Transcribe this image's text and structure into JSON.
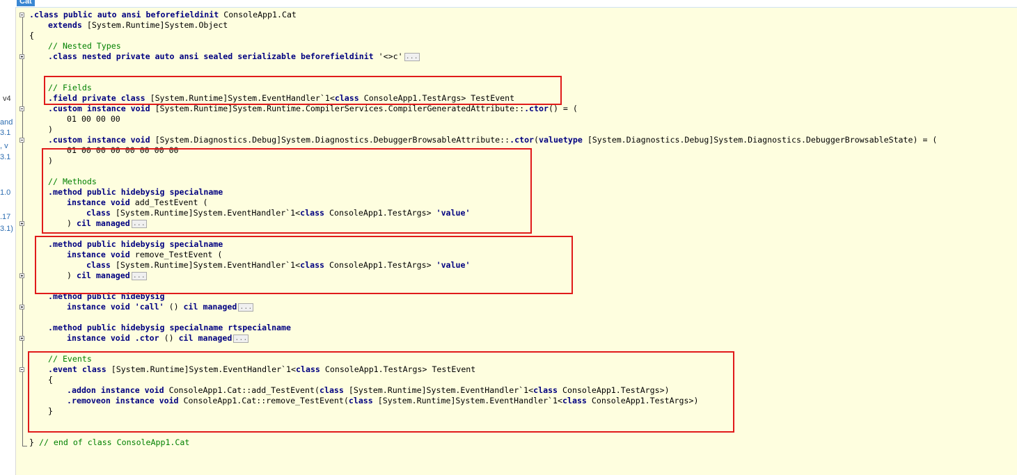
{
  "tab": {
    "label": "Cat"
  },
  "left_pane_fragments": [
    "v4",
    "and",
    "3.1",
    ", v",
    "3.1",
    "1.0",
    ".17",
    "3.1)"
  ],
  "code": {
    "class_line": {
      "kw": ".class public auto ansi beforefieldinit",
      "name": " ConsoleApp1.Cat"
    },
    "extends_line": {
      "kw": "extends",
      "text": " [System.Runtime]System.Object"
    },
    "brace_open": "{",
    "nested_comment": "// Nested Types",
    "nested_line": {
      "kw": ".class nested private auto ansi sealed serializable beforefieldinit",
      "text": " '<>c'"
    },
    "fields_comment": "// Fields",
    "field_line": {
      "kw1": ".field private class",
      "text1": " [System.Runtime]System.EventHandler`1<",
      "kw2": "class",
      "text2": " ConsoleApp1.TestArgs> TestEvent"
    },
    "custom1_line": {
      "kw1": ".custom instance void",
      "text1": " [System.Runtime]System.Runtime.CompilerServices.CompilerGeneratedAttribute::",
      "kw2": ".ctor",
      "text2": "() = ("
    },
    "bytes1": "01 00 00 00",
    "paren_close1": ")",
    "custom2_line": {
      "kw1": ".custom instance void",
      "text1": " [System.Diagnostics.Debug]System.Diagnostics.DebuggerBrowsableAttribute::",
      "kw2": ".ctor",
      "text2": "(",
      "kw3": "valuetype",
      "text3": " [System.Diagnostics.Debug]System.Diagnostics.DebuggerBrowsableState) = ("
    },
    "bytes2": "01 00 00 00 00 00 00 00",
    "paren_close2": ")",
    "methods_comment": "// Methods",
    "add_method": {
      "decl": ".method public hidebysig specialname",
      "sig_kw": "instance void",
      "sig_text": " add_TestEvent (",
      "param_kw": "class",
      "param_text": " [System.Runtime]System.EventHandler`1<",
      "param_kw2": "class",
      "param_text2": " ConsoleApp1.TestArgs> ",
      "param_name": "'value'",
      "close": ") ",
      "tail_kw": "cil managed"
    },
    "remove_method": {
      "decl": ".method public hidebysig specialname",
      "sig_kw": "instance void",
      "sig_text": " remove_TestEvent (",
      "param_kw": "class",
      "param_text": " [System.Runtime]System.EventHandler`1<",
      "param_kw2": "class",
      "param_text2": " ConsoleApp1.TestArgs> ",
      "param_name": "'value'",
      "close": ") ",
      "tail_kw": "cil managed"
    },
    "call_method": {
      "decl": ".method public hidebysig",
      "sig_kw": "instance void",
      "name": " 'call'",
      "mid": " () ",
      "tail_kw": "cil managed"
    },
    "ctor_method": {
      "decl": ".method public hidebysig specialname rtspecialname",
      "sig_kw": "instance void",
      "name_kw": ".ctor",
      "mid": " () ",
      "tail_kw": "cil managed"
    },
    "events_comment": "// Events",
    "event_line": {
      "kw1": ".event class",
      "text1": " [System.Runtime]System.EventHandler`1<",
      "kw2": "class",
      "text2": " ConsoleApp1.TestArgs> TestEvent"
    },
    "event_brace_open": "{",
    "addon_line": {
      "kw1": ".addon instance void",
      "text1": " ConsoleApp1.Cat::add_TestEvent(",
      "kw2": "class",
      "text2": " [System.Runtime]System.EventHandler`1<",
      "kw3": "class",
      "text3": " ConsoleApp1.TestArgs>)"
    },
    "removeon_line": {
      "kw1": ".removeon instance void",
      "text1": " ConsoleApp1.Cat::remove_TestEvent(",
      "kw2": "class",
      "text2": " [System.Runtime]System.EventHandler`1<",
      "kw3": "class",
      "text3": " ConsoleApp1.TestArgs>)"
    },
    "event_brace_close": "}",
    "end_brace": "}",
    "end_comment": " // end of class ConsoleApp1.Cat",
    "ellipsis": "..."
  },
  "colors": {
    "keyword": "#000080",
    "comment": "#008000",
    "highlight_box": "#e01a1a",
    "editor_bg": "#fefedf",
    "tab_bg": "#3a87d3"
  }
}
